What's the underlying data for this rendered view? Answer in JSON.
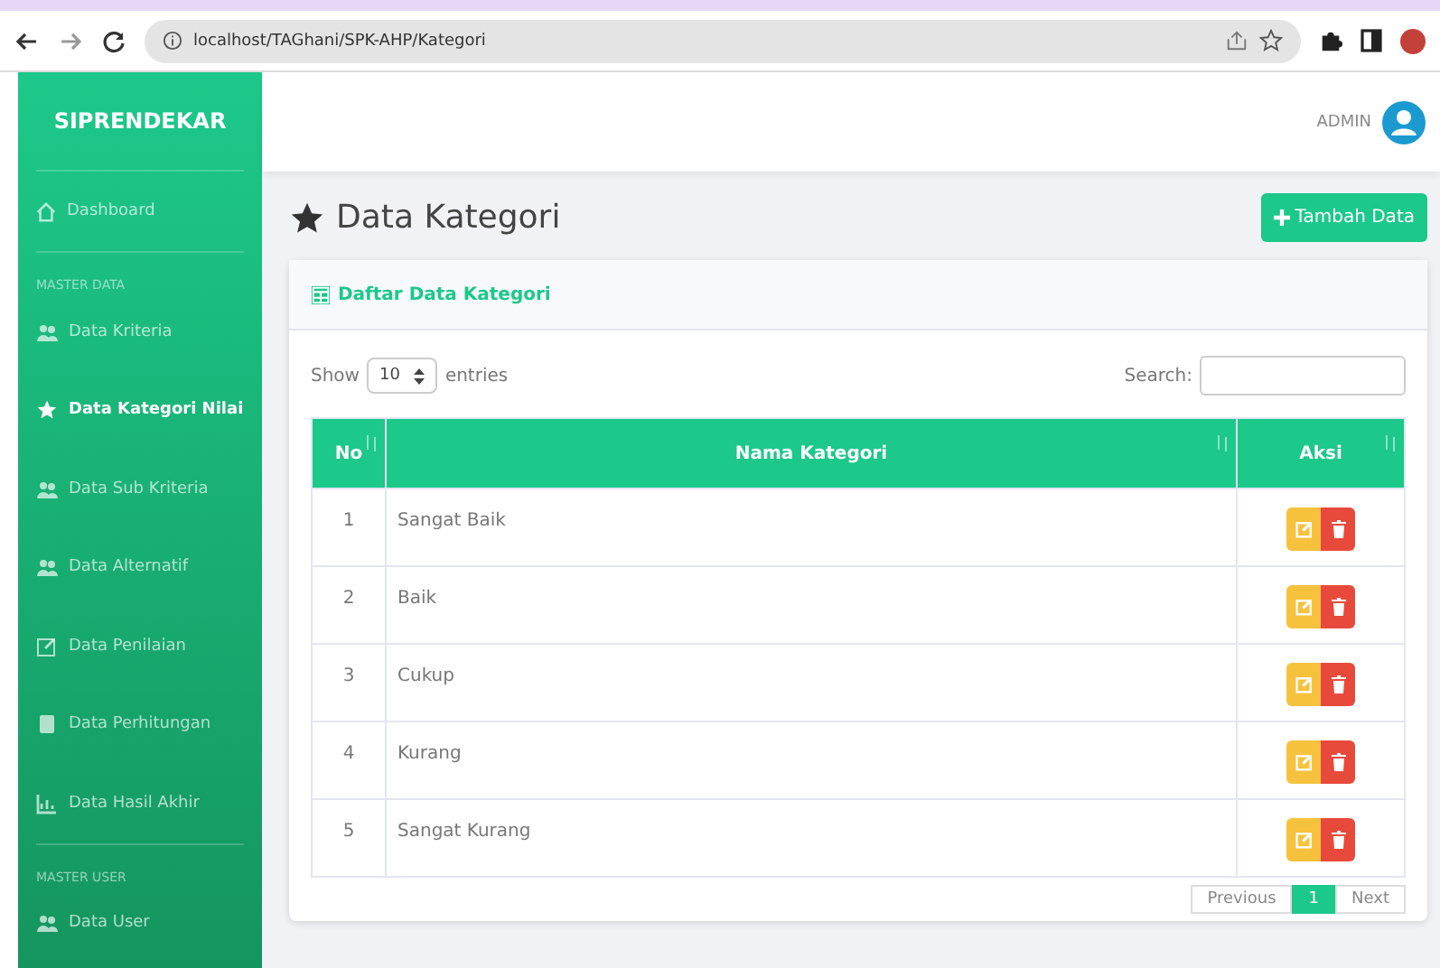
{
  "browser": {
    "url": "localhost/TAGhani/SPK-AHP/Kategori"
  },
  "sidebar": {
    "brand": "SIPRENDEKAR",
    "dashboard": {
      "label": "Dashboard",
      "selected": false
    },
    "sections": [
      {
        "heading": "MASTER DATA",
        "items": [
          {
            "label": "Data Kriteria",
            "selected": false
          },
          {
            "label": "Data Kategori Nilai",
            "selected": true
          },
          {
            "label": "Data Sub Kriteria",
            "selected": false
          },
          {
            "label": "Data Alternatif",
            "selected": false
          },
          {
            "label": "Data Penilaian",
            "selected": false
          },
          {
            "label": "Data Perhitungan",
            "selected": false
          },
          {
            "label": "Data Hasil Akhir",
            "selected": false
          }
        ]
      },
      {
        "heading": "MASTER USER",
        "items": [
          {
            "label": "Data User",
            "selected": false
          }
        ]
      }
    ]
  },
  "topbar": {
    "user": "ADMIN"
  },
  "page": {
    "title": "Data Kategori",
    "add_button": "Tambah Data"
  },
  "card": {
    "title": "Daftar Data Kategori",
    "show_label": "Show",
    "page_size": "10",
    "entries_label": "entries",
    "search_label": "Search:",
    "table": {
      "columns": [
        "No",
        "Nama Kategori",
        "Aksi"
      ],
      "rows": [
        {
          "no": "1",
          "name": "Sangat Baik"
        },
        {
          "no": "2",
          "name": "Baik"
        },
        {
          "no": "3",
          "name": "Cukup"
        },
        {
          "no": "4",
          "name": "Kurang"
        },
        {
          "no": "5",
          "name": "Sangat Kurang"
        }
      ]
    },
    "pagination": [
      {
        "label": "Previous",
        "selected": false
      },
      {
        "label": "1",
        "selected": true
      },
      {
        "label": "Next",
        "selected": false
      }
    ]
  }
}
